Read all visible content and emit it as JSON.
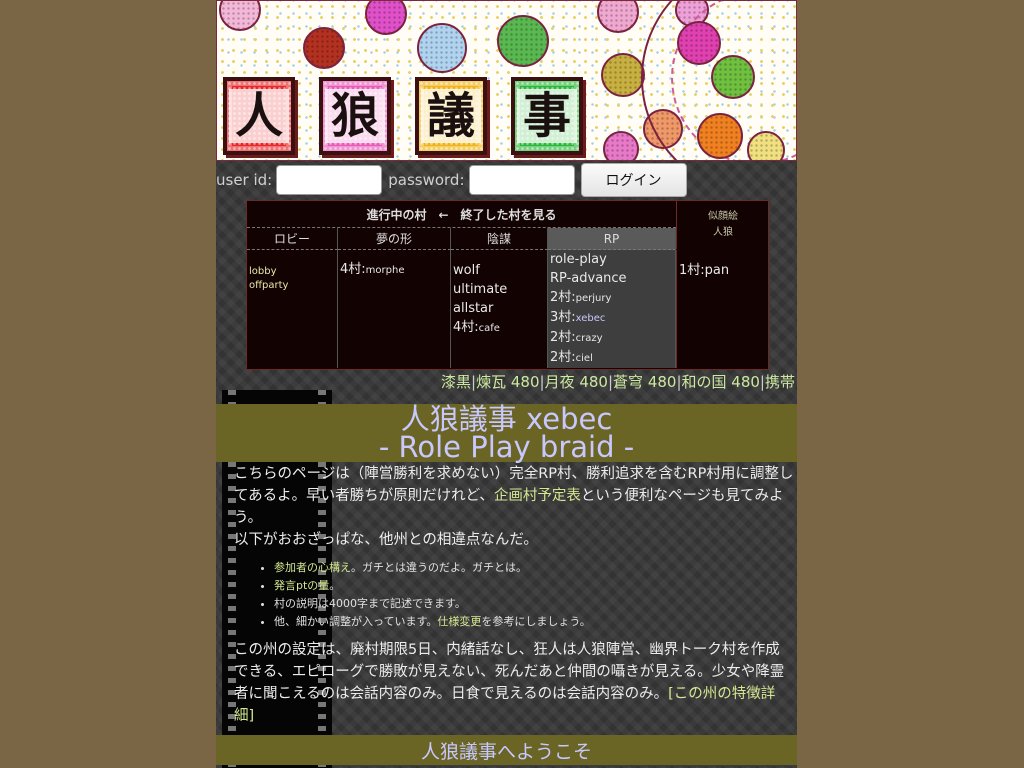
{
  "banner": {
    "kanji": [
      "人",
      "狼",
      "議",
      "事"
    ],
    "colors": {
      "kanji_1": "#e8282a",
      "kanji_2": "#e85ab8",
      "kanji_3": "#f0b418",
      "kanji_4": "#2cb83a"
    }
  },
  "login": {
    "user_label": "user id:",
    "password_label": "password:",
    "button_label": "ログイン"
  },
  "villages": {
    "header": "進行中の村　←　終了した村を見る",
    "side": [
      "似顔絵",
      "人狼"
    ],
    "columns": [
      {
        "label": "ロビー",
        "items": [
          "lobby",
          "offparty"
        ]
      },
      {
        "label": "夢の形",
        "items": [
          {
            "prefix": "4村:",
            "name": "morphe"
          }
        ]
      },
      {
        "label": "陰謀",
        "items": [
          "wolf",
          "ultimate",
          "allstar",
          {
            "prefix": "4村:",
            "name": "cafe"
          }
        ]
      },
      {
        "label": "RP",
        "items": [
          "role-play",
          "RP-advance",
          {
            "prefix": "2村:",
            "name": "perjury"
          },
          {
            "prefix": "3村:",
            "name": "xebec"
          },
          {
            "prefix": "2村:",
            "name": "crazy"
          },
          {
            "prefix": "2村:",
            "name": "ciel"
          }
        ]
      }
    ],
    "side_item": "1村:pan"
  },
  "styles": [
    "漆黒",
    "煉瓦 480",
    "月夜 480",
    "蒼穹 480",
    "和の国 480",
    "携帯"
  ],
  "title": {
    "line1": "人狼議事 xebec",
    "line2": "- Role Play braid -"
  },
  "intro": {
    "p1a": "こちらのページは（陣営勝利を求めない）完全RP村、勝利追求を含むRP村用に調整してあるよ。早い者勝ちが原則だけれど、",
    "p1_link": "企画村予定表",
    "p1b": "という便利なページも見てみよう。",
    "p2": "以下がおおざっぱな、他州との相違点なんだ。"
  },
  "rules": [
    {
      "pre": "",
      "link": "参加者の心構え",
      "post": "。ガチとは違うのだよ。ガチとは。"
    },
    {
      "pre": "",
      "link": "発言ptの量",
      "post": "。"
    },
    {
      "pre": "村の説明は4000字まで記述できます。",
      "link": "",
      "post": ""
    },
    {
      "pre": "他、細かい調整が入っています。",
      "link": "仕様変更",
      "post": "を参考にしましょう。"
    }
  ],
  "settings": {
    "text": "この州の設定は、廃村期限5日、内緒話なし、狂人は人狼陣営、幽界トーク村を作成できる、エピローグで勝敗が見えない、死んだあと仲間の囁きが見える。少女や降霊者に聞こえるのは会話内容のみ。日食で見えるのは会話内容のみ。",
    "link": "[この州の特徴詳細]"
  },
  "welcome": "人狼議事へようこそ"
}
